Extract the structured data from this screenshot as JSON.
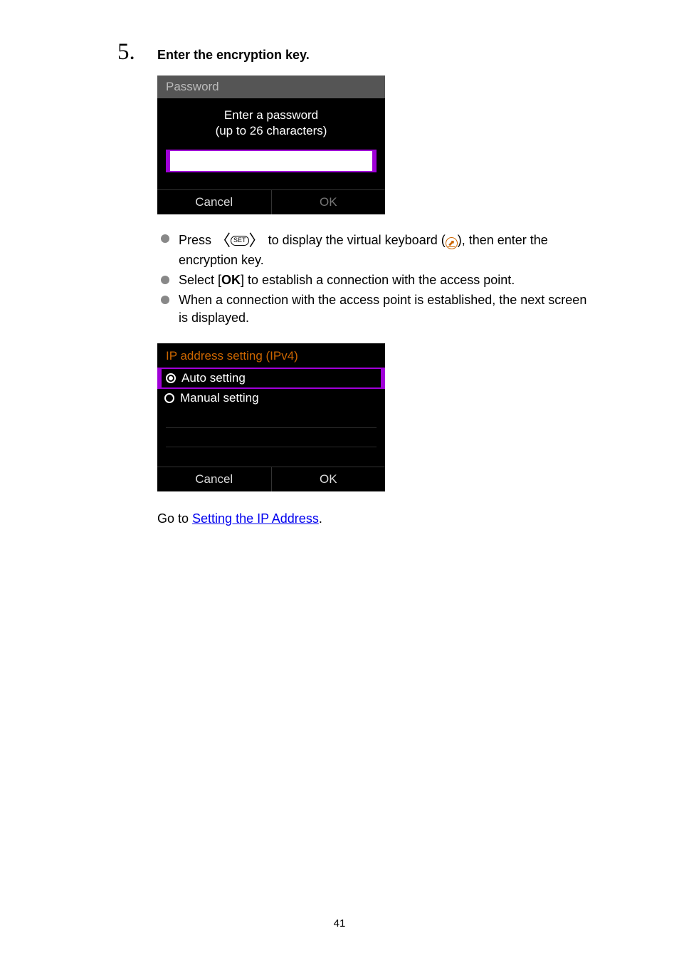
{
  "step": {
    "number": "5.",
    "title": "Enter the encryption key."
  },
  "passwordScreen": {
    "title": "Password",
    "prompt1": "Enter a password",
    "prompt2": "(up to 26 characters)",
    "cancel": "Cancel",
    "ok": "OK"
  },
  "bullets": {
    "b1_pre": "Press ",
    "b1_set": "SET",
    "b1_mid": " to display the virtual keyboard (",
    "b1_post": "), then enter the encryption key.",
    "b2_pre": "Select [",
    "b2_bold": "OK",
    "b2_post": "] to establish a connection with the access point.",
    "b3": "When a connection with the access point is established, the next screen is displayed."
  },
  "ipScreen": {
    "title": "IP address setting (IPv4)",
    "auto": "Auto setting",
    "manual": "Manual setting",
    "cancel": "Cancel",
    "ok": "OK"
  },
  "goto": {
    "pre": "Go to ",
    "link": "Setting the IP Address",
    "post": "."
  },
  "pageNumber": "41"
}
